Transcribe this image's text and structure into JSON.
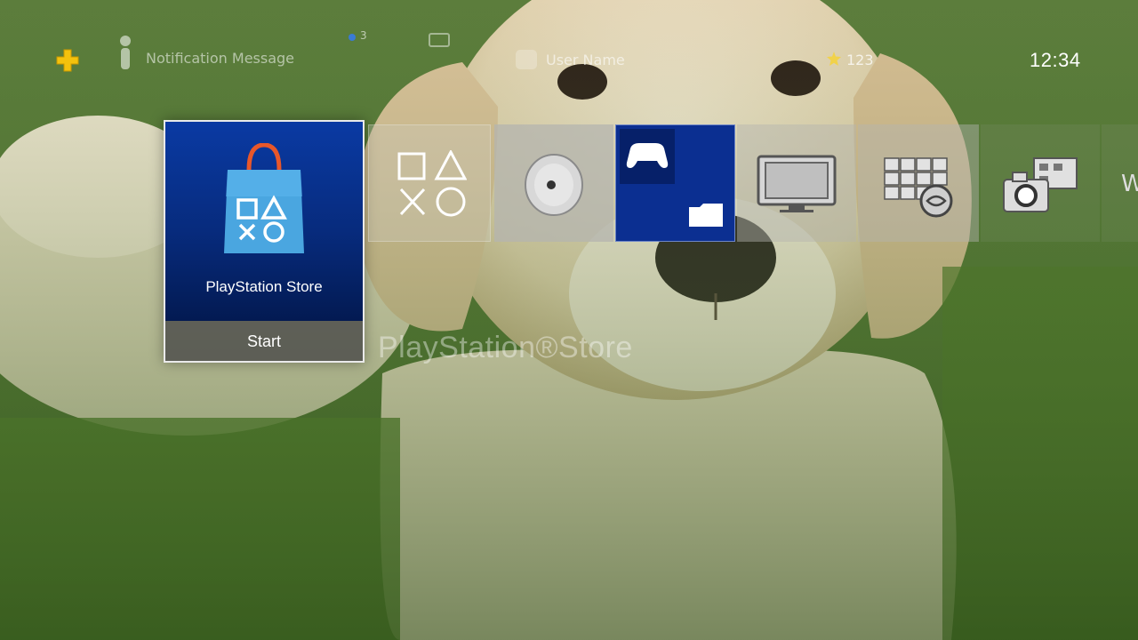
{
  "status_bar": {
    "notification_text": "Notification Message",
    "friends_count": "3",
    "user_name": "User Name",
    "trophy_count": "123",
    "clock": "12:34",
    "colors": {
      "plus": "#f4c20d",
      "friends": "#3a7bd5"
    }
  },
  "tiles": [
    {
      "name": "playstation-store",
      "label": "PlayStation Store",
      "action": "Start",
      "selected": true
    },
    {
      "name": "playstation-symbols",
      "icon": "ps-shapes-icon"
    },
    {
      "name": "disc",
      "icon": "disc-icon"
    },
    {
      "name": "library",
      "icon": "library-icon"
    },
    {
      "name": "tv-video",
      "icon": "tv-icon"
    },
    {
      "name": "applications",
      "icon": "apps-grid-icon"
    },
    {
      "name": "capture-gallery",
      "icon": "camera-icon"
    },
    {
      "name": "web-browser",
      "icon": "www-icon",
      "partial_text": "W"
    }
  ],
  "selected_title": "PlayStation®Store",
  "colors": {
    "store_blue": "#0a3aa3",
    "library_blue": "#0b2f91"
  }
}
